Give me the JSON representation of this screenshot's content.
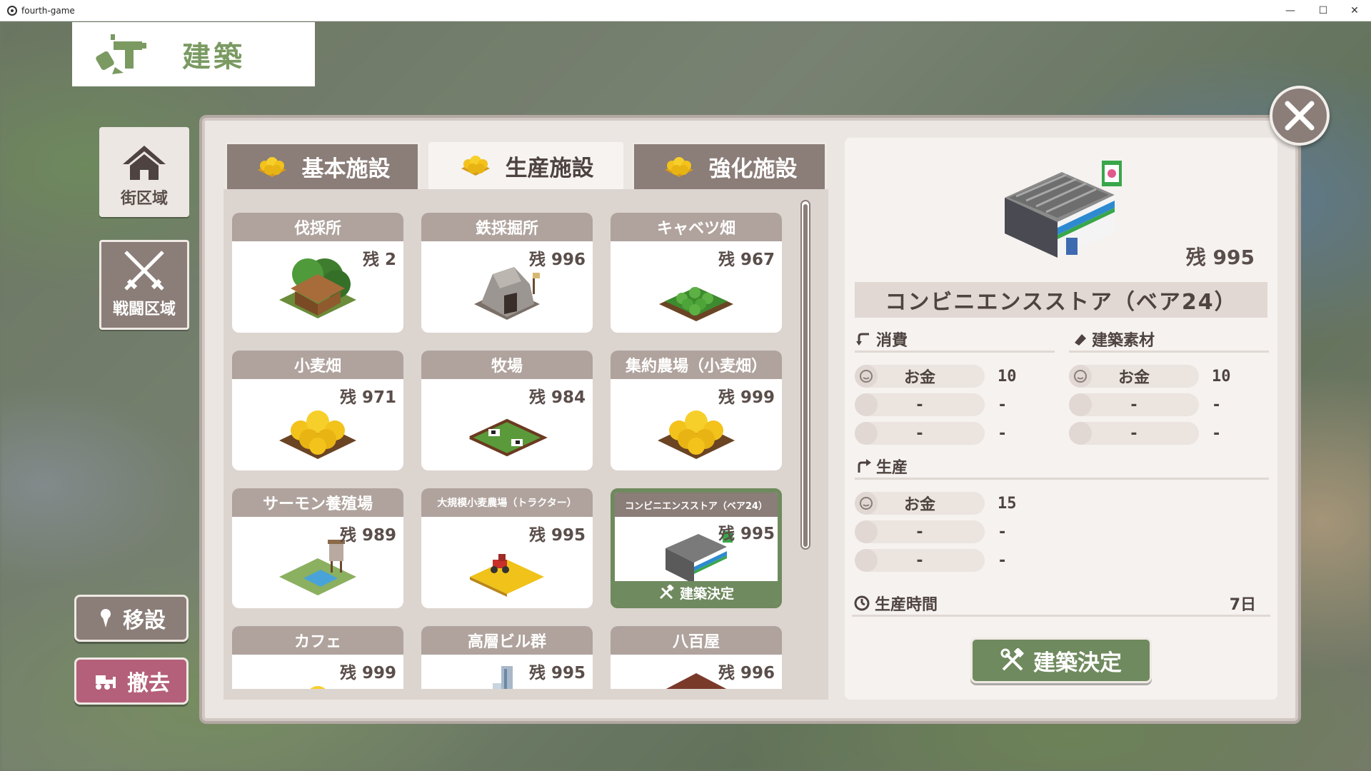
{
  "window": {
    "title": "fourth-game"
  },
  "header": {
    "title": "建築"
  },
  "nav": {
    "town_label": "街区域",
    "battle_label": "戦闘区域",
    "move_label": "移設",
    "remove_label": "撤去"
  },
  "tabs": [
    {
      "label": "基本施設",
      "active": false
    },
    {
      "label": "生産施設",
      "active": true
    },
    {
      "label": "強化施設",
      "active": false
    }
  ],
  "cards": [
    {
      "name": "伐採所",
      "remain": "残 2",
      "icon": "lumber-mill-icon"
    },
    {
      "name": "鉄採掘所",
      "remain": "残 996",
      "icon": "iron-mine-icon"
    },
    {
      "name": "キャベツ畑",
      "remain": "残 967",
      "icon": "cabbage-field-icon"
    },
    {
      "name": "小麦畑",
      "remain": "残 971",
      "icon": "wheat-field-icon"
    },
    {
      "name": "牧場",
      "remain": "残 984",
      "icon": "ranch-icon"
    },
    {
      "name": "集約農場（小麦畑）",
      "remain": "残 999",
      "icon": "wheat-field-icon"
    },
    {
      "name": "サーモン養殖場",
      "remain": "残 989",
      "icon": "salmon-farm-icon"
    },
    {
      "name": "大規模小麦農場（トラクター）",
      "remain": "残 995",
      "icon": "tractor-farm-icon"
    },
    {
      "name": "コンビニエンスストア（ベア24）",
      "remain": "残 995",
      "icon": "convenience-store-icon",
      "selected": true,
      "decide_label": "建築決定"
    },
    {
      "name": "カフェ",
      "remain": "残 999",
      "icon": "wheat-field-icon"
    },
    {
      "name": "高層ビル群",
      "remain": "残 995",
      "icon": "skyscraper-icon"
    },
    {
      "name": "八百屋",
      "remain": "残 996",
      "icon": "grocer-icon"
    }
  ],
  "detail": {
    "remain": "残 995",
    "name": "コンビニエンスストア（ベア24）",
    "consume_title": "消費",
    "material_title": "建築素材",
    "produce_title": "生産",
    "time_title": "生産時間",
    "time_value": "7日",
    "consume": [
      {
        "label": "お金",
        "value": "10"
      },
      {
        "label": "-",
        "value": "-"
      },
      {
        "label": "-",
        "value": "-"
      }
    ],
    "material": [
      {
        "label": "お金",
        "value": "10"
      },
      {
        "label": "-",
        "value": "-"
      },
      {
        "label": "-",
        "value": "-"
      }
    ],
    "produce": [
      {
        "label": "お金",
        "value": "15"
      },
      {
        "label": "-",
        "value": "-"
      },
      {
        "label": "-",
        "value": "-"
      }
    ],
    "build_label": "建築決定"
  },
  "colors": {
    "accent_green": "#6f8a5e",
    "panel_brown": "#8b7d78",
    "remove_pink": "#b4607a",
    "header_green": "#7a9a62"
  }
}
